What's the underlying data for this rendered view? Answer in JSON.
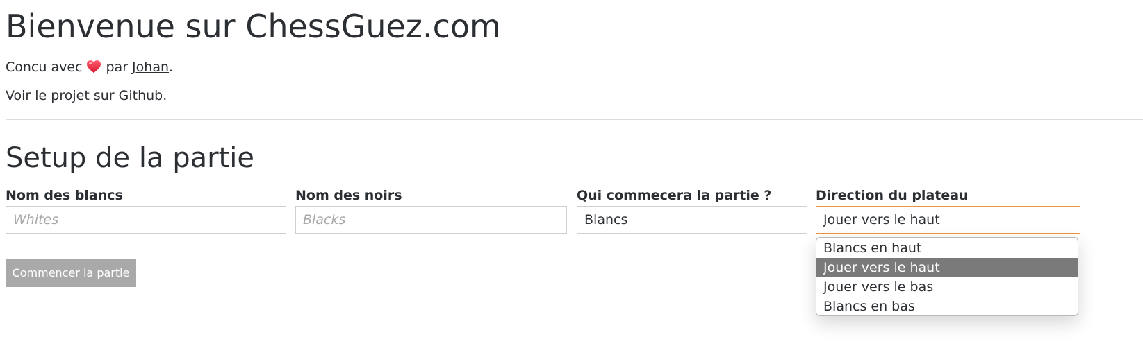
{
  "header": {
    "title": "Bienvenue sur ChessGuez.com",
    "credit_prefix": "Concu avec",
    "credit_icon": "heart-icon",
    "credit_middle": "par",
    "author_link": "Johan",
    "credit_suffix": ".",
    "project_prefix": "Voir le projet sur",
    "github_link": "Github",
    "project_suffix": "."
  },
  "setup": {
    "title": "Setup de la partie",
    "fields": {
      "whites": {
        "label": "Nom des blancs",
        "value": "",
        "placeholder": "Whites"
      },
      "blacks": {
        "label": "Nom des noirs",
        "value": "",
        "placeholder": "Blacks"
      },
      "first_player": {
        "label": "Qui commecera la partie ?",
        "value": "Blancs"
      },
      "board_direction": {
        "label": "Direction du plateau",
        "value": "Jouer vers le haut",
        "options": [
          "Blancs en haut",
          "Jouer vers le haut",
          "Jouer vers le bas",
          "Blancs en bas"
        ],
        "selected_index": 1
      }
    },
    "start_button": "Commencer la partie"
  },
  "colors": {
    "text": "#2b2f33",
    "heart": "#e8263a",
    "focus_border": "#e8963c",
    "button_bg": "#a9a9a9",
    "selected_option_bg": "#7a7a7a"
  }
}
